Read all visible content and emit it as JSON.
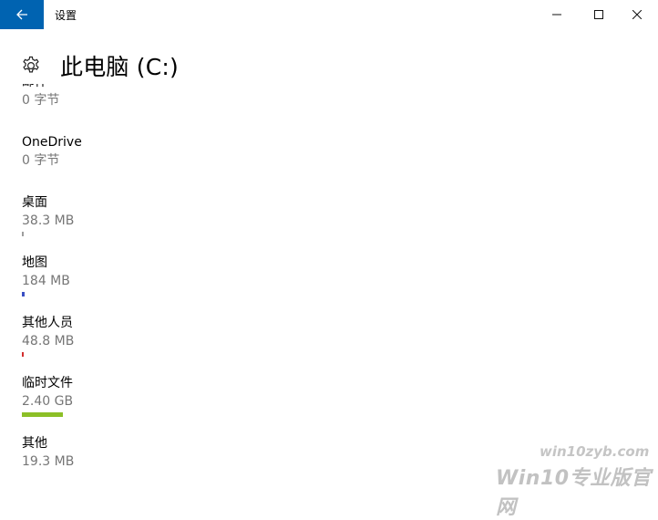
{
  "window": {
    "app_title": "设置",
    "back_icon": "arrow-left-icon",
    "minimize_icon": "minimize-icon",
    "maximize_icon": "maximize-icon",
    "close_icon": "close-icon",
    "accent_color": "#0063b1"
  },
  "header": {
    "icon": "gear-icon",
    "title": "此电脑 (C:)"
  },
  "storage_items": [
    {
      "name": "邮件",
      "size": "0 字节",
      "usage_fraction": 0,
      "bar_color": ""
    },
    {
      "name": "OneDrive",
      "size": "0 字节",
      "usage_fraction": 0,
      "bar_color": ""
    },
    {
      "name": "桌面",
      "size": "38.3 MB",
      "usage_fraction": 0.003,
      "bar_color": "#9e9e9e"
    },
    {
      "name": "地图",
      "size": "184 MB",
      "usage_fraction": 0.01,
      "bar_color": "#3a4fc4"
    },
    {
      "name": "其他人员",
      "size": "48.8 MB",
      "usage_fraction": 0.004,
      "bar_color": "#d32f2f"
    },
    {
      "name": "临时文件",
      "size": "2.40 GB",
      "usage_fraction": 0.15,
      "bar_color": "#8cbf26"
    },
    {
      "name": "其他",
      "size": "19.3 MB",
      "usage_fraction": 0,
      "bar_color": ""
    }
  ],
  "watermark": {
    "url_text": "win10zyb.com",
    "brand_text": "Win10专业版官网"
  }
}
